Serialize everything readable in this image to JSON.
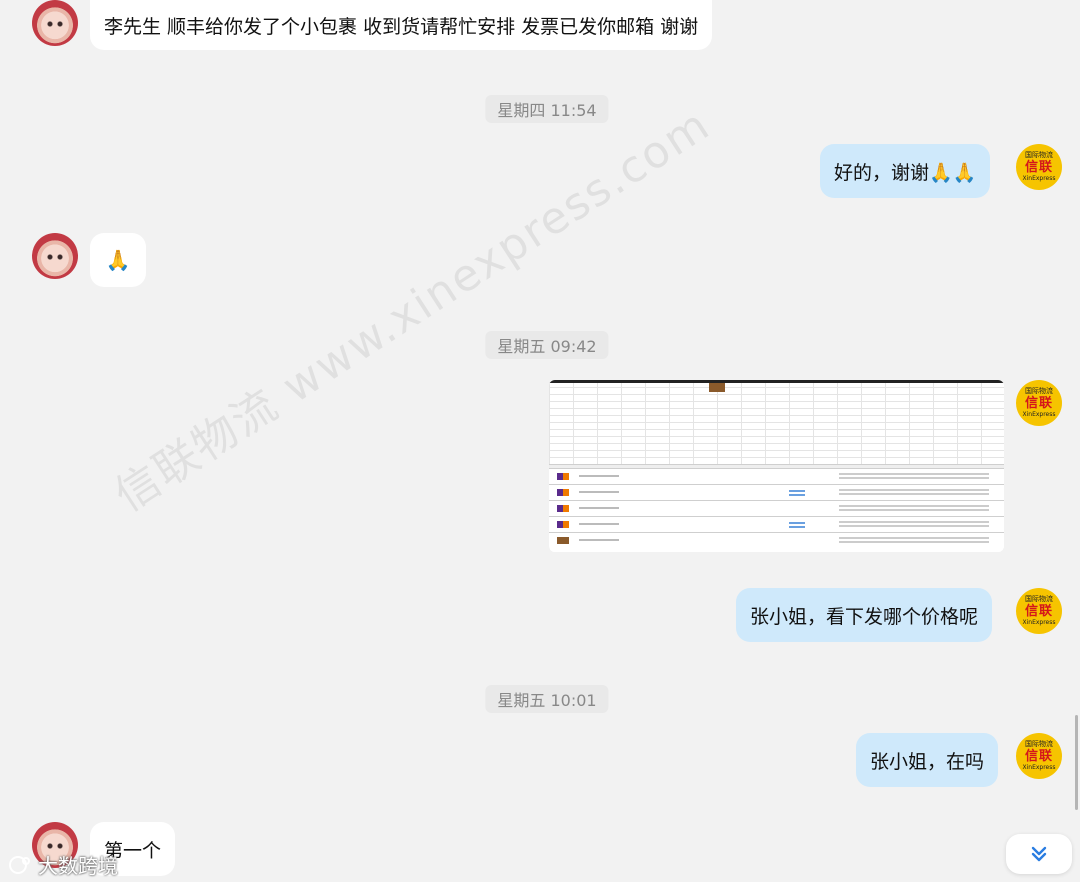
{
  "messages": [
    {
      "side": "left",
      "text": "李先生 顺丰给你发了个小包裹 收到货请帮忙安排 发票已发你邮箱 谢谢"
    },
    {
      "time": "星期四 11:54"
    },
    {
      "side": "right",
      "text": "好的，谢谢🙏🙏"
    },
    {
      "side": "left",
      "text": "🙏"
    },
    {
      "time": "星期五 09:42"
    },
    {
      "side": "right",
      "type": "image",
      "watermark": "xinexpress.com"
    },
    {
      "side": "right",
      "text": "张小姐，看下发哪个价格呢"
    },
    {
      "time": "星期五 10:01"
    },
    {
      "side": "right",
      "text": "张小姐，在吗"
    },
    {
      "side": "left",
      "text": "第一个"
    }
  ],
  "brand_avatar": {
    "line1": "国际物流",
    "line2": "信联",
    "line3": "XinExpress"
  },
  "watermark_text": "信联物流 www.xinexpress.com",
  "footer_logo": "大数跨境",
  "icons": {
    "scroll_down": "double-chevron-down-icon"
  },
  "colors": {
    "bg": "#f2f2f2",
    "left_bubble": "#ffffff",
    "right_bubble": "#cfe9fb",
    "brand": "#f6c400",
    "brand_text": "#d4161b",
    "chevron": "#2a7de1"
  }
}
